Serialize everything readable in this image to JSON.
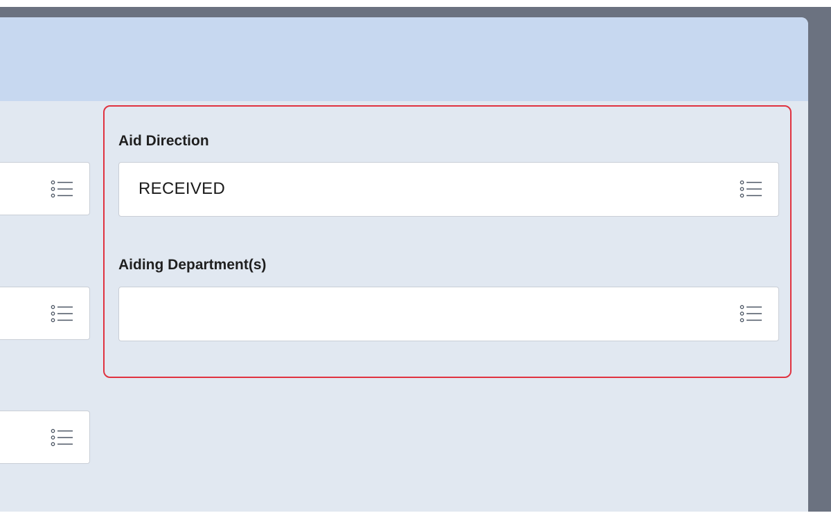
{
  "form": {
    "aid_direction": {
      "label": "Aid Direction",
      "value": "RECEIVED",
      "icon": "list-icon"
    },
    "aiding_departments": {
      "label": "Aiding Department(s)",
      "value": "",
      "icon": "list-icon"
    }
  },
  "left_column_fields": [
    {
      "value": "",
      "icon": "list-icon"
    },
    {
      "value": "",
      "icon": "list-icon"
    },
    {
      "value": "",
      "icon": "list-icon"
    }
  ],
  "colors": {
    "panel_background": "#e1e8f1",
    "header_background": "#c7d8f0",
    "highlight_border": "#e0313f",
    "frame": "#6b7280"
  }
}
